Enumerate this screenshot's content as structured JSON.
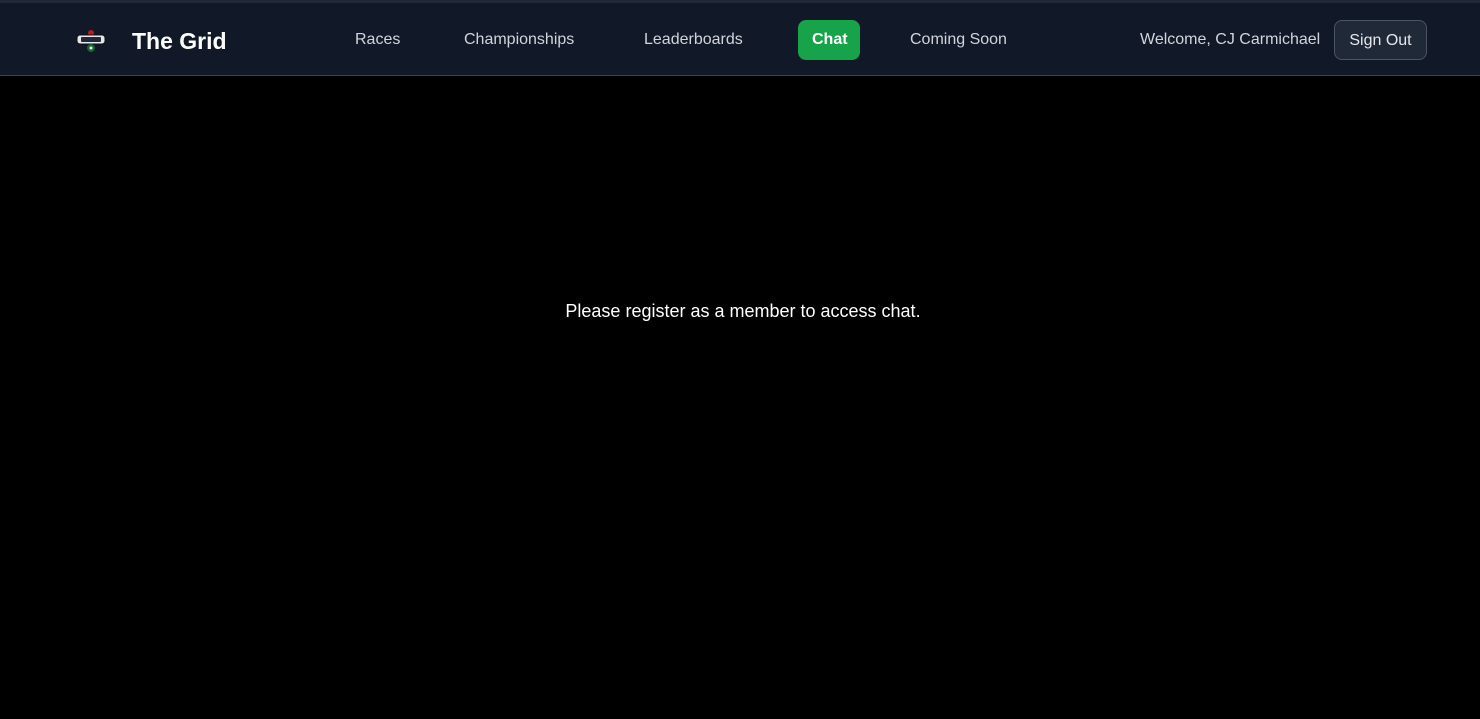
{
  "header": {
    "brand": "The Grid",
    "logo_icon": "racing-club-logo-icon",
    "nav": [
      {
        "label": "Races",
        "active": false
      },
      {
        "label": "Championships",
        "active": false
      },
      {
        "label": "Leaderboards",
        "active": false
      },
      {
        "label": "Chat",
        "active": true
      },
      {
        "label": "Coming Soon",
        "active": false
      }
    ],
    "welcome": "Welcome, CJ Carmichael",
    "signout_label": "Sign Out"
  },
  "main": {
    "message": "Please register as a member to access chat."
  },
  "colors": {
    "header_bg": "#111827",
    "page_bg": "#000000",
    "accent": "#16a34a",
    "nav_text": "#d1d5db"
  }
}
